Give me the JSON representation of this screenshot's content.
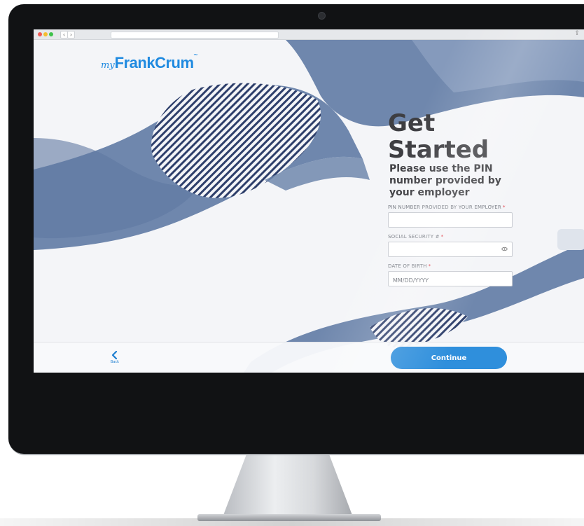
{
  "brand": {
    "prefix": "my",
    "name": "FrankCrum",
    "trademark": "™",
    "color": "#1f8ae0"
  },
  "browser": {
    "back_icon": "‹",
    "forward_icon": "›",
    "share_icon": "⇪"
  },
  "form": {
    "title": "Get Started",
    "subtitle": "Please use the PIN number provided by your employer",
    "required_marker": "*",
    "fields": [
      {
        "label": "PIN NUMBER PROVIDED BY YOUR EMPLOYER",
        "value": "",
        "placeholder": ""
      },
      {
        "label": "SOCIAL SECURITY #",
        "value": "",
        "placeholder": "",
        "icon": "eye-icon"
      },
      {
        "label": "DATE OF BIRTH",
        "value": "",
        "placeholder": "MM/DD/YYYY"
      }
    ]
  },
  "footer": {
    "back_label": "Back",
    "continue_label": "Continue"
  },
  "colors": {
    "accent": "#2f8fdc",
    "wave": "#6f87ad",
    "required": "#e0323b"
  }
}
